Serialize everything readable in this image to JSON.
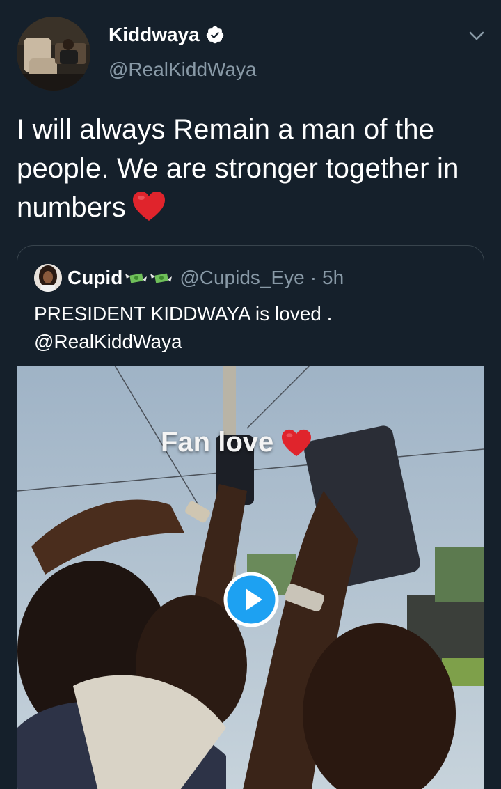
{
  "tweet": {
    "author": {
      "display_name": "Kiddwaya",
      "handle": "@RealKiddWaya",
      "verified_icon": "verified-badge-icon"
    },
    "menu_icon": "chevron-down-icon",
    "text": "I will always Remain a man of the people. We are stronger together in numbers",
    "text_emoji": "red-heart-emoji"
  },
  "quoted_tweet": {
    "display_name": "Cupid",
    "name_emojis": [
      "money-with-wings-emoji",
      "money-with-wings-emoji"
    ],
    "handle": "@Cupids_Eye",
    "separator": "·",
    "time": "5h",
    "text_line1": "PRESIDENT KIDDWAYA is loved .",
    "text_line2": "@RealKiddWaya",
    "media": {
      "type": "video",
      "overlay_caption": "Fan love",
      "overlay_emoji": "red-heart-emoji",
      "play_icon": "play-icon"
    }
  },
  "colors": {
    "background": "#15202b",
    "text_primary": "#ffffff",
    "text_secondary": "#8899a6",
    "border": "#38444d",
    "accent": "#1da1f2"
  }
}
